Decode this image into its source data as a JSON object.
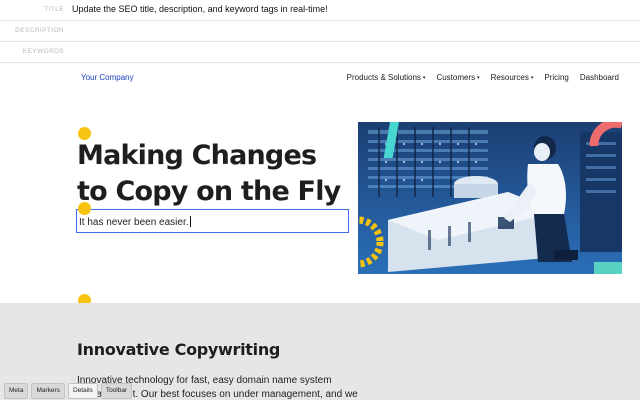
{
  "meta": {
    "fields": [
      {
        "label": "TITLE",
        "value": "Update the SEO title, description, and keyword tags in real-time!"
      },
      {
        "label": "DESCRIPTION",
        "value": ""
      },
      {
        "label": "KEYWORDS",
        "value": ""
      }
    ]
  },
  "site": {
    "logo": "Your Company",
    "nav": [
      {
        "label": "Products & Solutions",
        "caret": "▾"
      },
      {
        "label": "Customers",
        "caret": "▾"
      },
      {
        "label": "Resources",
        "caret": "▾"
      },
      {
        "label": "Pricing",
        "caret": ""
      },
      {
        "label": "Dashboard",
        "caret": ""
      }
    ]
  },
  "hero": {
    "title_line1": "Making Changes",
    "title_line2": "to Copy on the Fly",
    "editable_text": "It has never been easier."
  },
  "section": {
    "heading": "Innovative Copywriting",
    "body": "Innovative technology for fast, easy domain name system management. Our best focuses on under management, and we"
  },
  "toolbar": {
    "buttons": [
      {
        "label": "Meta",
        "active": false
      },
      {
        "label": "Markers",
        "active": false
      },
      {
        "label": "Details",
        "active": true
      },
      {
        "label": "Toolbar",
        "active": false
      }
    ]
  },
  "colors": {
    "marker": "#f6c310",
    "edit_outline": "#3f6fe8",
    "logo": "#1a3fc4",
    "image_tint": "#1f5fa6",
    "grey_section": "#e6e6e6"
  }
}
